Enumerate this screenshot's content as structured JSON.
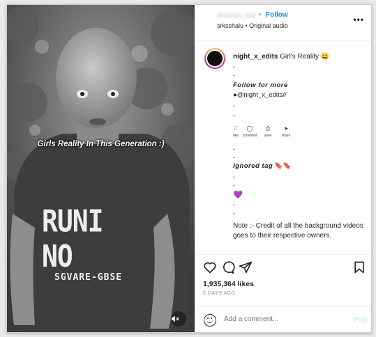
{
  "media": {
    "overlay_caption": "Girls Reality In This Generation :)",
    "shirt_line1": "RUNI NO",
    "shirt_line2": "SGVARE-GBSE",
    "mute_icon": "muted-speaker-icon"
  },
  "header": {
    "username": "xxxxxxx_xxx",
    "separator": "•",
    "follow_label": "Follow",
    "subline": "srksshalu • Original audio",
    "more_icon": "•••"
  },
  "caption": {
    "author": "night_x_edits",
    "text": "Girl's Reality 😄",
    "dot1": ".",
    "dot2": ".",
    "follow_more": "Follow for more",
    "handle": "●@night_x_edits//",
    "dot3": ".",
    "dot4": ".",
    "mini_icons": [
      "♡",
      "◯",
      "⎙",
      "➤"
    ],
    "mini_labels": [
      "like",
      "comment",
      "save",
      "share"
    ],
    "dot5": ".",
    "dot6": ".",
    "ignored": "Ignored tag",
    "ignored_emoji": "🔖🔖",
    "dot7": ".",
    "dot8": ".",
    "purple_heart": "💜",
    "dot9": ".",
    "dot10": ".",
    "note": "Note :- Credit of all the background videos goes to their respective owners."
  },
  "actions": {
    "likes": "1,935,364 likes",
    "date": "5 DAYS AGO"
  },
  "comment_box": {
    "placeholder": "Add a comment...",
    "post_label": "Post"
  },
  "colors": {
    "link_blue": "#0095f6",
    "post_disabled": "#b2dffc",
    "text": "#262626",
    "muted": "#8e8e8e"
  }
}
